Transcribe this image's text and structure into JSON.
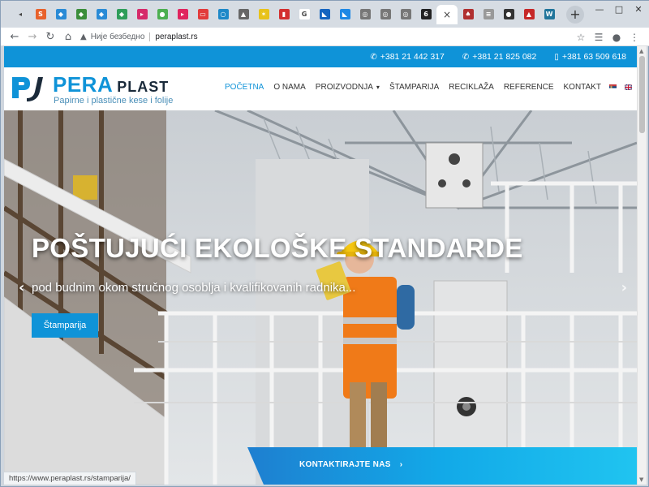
{
  "browser": {
    "tabs": [
      {
        "icon": "back-arrow-icon",
        "color": "#d6dce3",
        "glyph": "◂"
      },
      {
        "icon": "orange-square-icon",
        "color": "#e8622c",
        "glyph": "S"
      },
      {
        "icon": "shield-icon",
        "color": "#2a8bd6",
        "glyph": "◆"
      },
      {
        "icon": "shield-icon",
        "color": "#3b8e3b",
        "glyph": "◆"
      },
      {
        "icon": "shield-icon",
        "color": "#2a8bd6",
        "glyph": "◆"
      },
      {
        "icon": "shield-icon",
        "color": "#2f9e5a",
        "glyph": "◆"
      },
      {
        "icon": "pink-square-icon",
        "color": "#d62a6a",
        "glyph": "▸"
      },
      {
        "icon": "green-circle-icon",
        "color": "#4caf50",
        "glyph": "●"
      },
      {
        "icon": "red-square-icon",
        "color": "#e0245e",
        "glyph": "▸"
      },
      {
        "icon": "red-square-icon",
        "color": "#e23b3b",
        "glyph": "▭"
      },
      {
        "icon": "pin-icon",
        "color": "#1e88c8",
        "glyph": "○"
      },
      {
        "icon": "gray-square-icon",
        "color": "#666666",
        "glyph": "▲"
      },
      {
        "icon": "yellow-square-icon",
        "color": "#e8c21a",
        "glyph": "✶"
      },
      {
        "icon": "red-square-icon",
        "color": "#d32f2f",
        "glyph": "▮"
      },
      {
        "icon": "google-icon",
        "color": "#ffffff",
        "glyph": "G"
      },
      {
        "icon": "blue-triangle-icon",
        "color": "#1565c0",
        "glyph": "◣"
      },
      {
        "icon": "blue-triangle-icon",
        "color": "#1e88e5",
        "glyph": "◣"
      },
      {
        "icon": "globe-icon",
        "color": "#777777",
        "glyph": "◎"
      },
      {
        "icon": "globe-icon",
        "color": "#777777",
        "glyph": "◎"
      },
      {
        "icon": "globe-icon",
        "color": "#777777",
        "glyph": "◎"
      },
      {
        "icon": "yellow-dark-icon",
        "color": "#222222",
        "glyph": "6"
      }
    ],
    "active_tab_close": "×",
    "tabs_after": [
      {
        "icon": "figure-icon",
        "color": "#b03030",
        "glyph": "♠"
      },
      {
        "icon": "text-icon",
        "color": "#999999",
        "glyph": "≡"
      },
      {
        "icon": "dark-circle-icon",
        "color": "#333333",
        "glyph": "●"
      },
      {
        "icon": "warning-icon",
        "color": "#c62828",
        "glyph": "▲"
      },
      {
        "icon": "wordpress-icon",
        "color": "#21759b",
        "glyph": "W"
      }
    ],
    "new_tab": "+",
    "window_controls": {
      "minimize": "—",
      "maximize": "□",
      "close": "✕"
    },
    "nav": {
      "back": "←",
      "forward": "→",
      "reload": "↻",
      "home": "⌂"
    },
    "security_icon": "▲",
    "security_label": "Није безбедно",
    "url": "peraplast.rs",
    "toolbar_icons": {
      "star": "☆",
      "reading_list": "☰",
      "profile": "●",
      "menu": "⋮"
    },
    "status_url": "https://www.peraplast.rs/stamparija/"
  },
  "site": {
    "colors": {
      "primary": "#0f93d8",
      "dark": "#1a2a3a"
    },
    "phones": [
      "+381 21 442 317",
      "+381 21 825 082",
      "+381 63 509 618"
    ],
    "phone_icons": [
      "phone-icon",
      "phone-icon",
      "mobile-icon"
    ],
    "brand_primary": "PERA",
    "brand_secondary": "PLAST",
    "tagline": "Papirne i plastične kese i folije",
    "nav": [
      {
        "label": "POČETNA",
        "active": true
      },
      {
        "label": "O NAMA"
      },
      {
        "label": "PROIZVODNJA",
        "dropdown": true
      },
      {
        "label": "ŠTAMPARIJA"
      },
      {
        "label": "RECIKLAŽA"
      },
      {
        "label": "REFERENCE"
      },
      {
        "label": "KONTAKT"
      }
    ],
    "hero": {
      "headline": "POŠTUJUĆI EKOLOŠKE STANDARDE",
      "subline": "pod budnim okom stručnog osoblja i kvalifikovanih radnika...",
      "cta": "Štamparija",
      "prev": "‹",
      "next": "›"
    },
    "contact_cta": "KONTAKTIRAJTE NAS",
    "contact_arrow": "›"
  }
}
